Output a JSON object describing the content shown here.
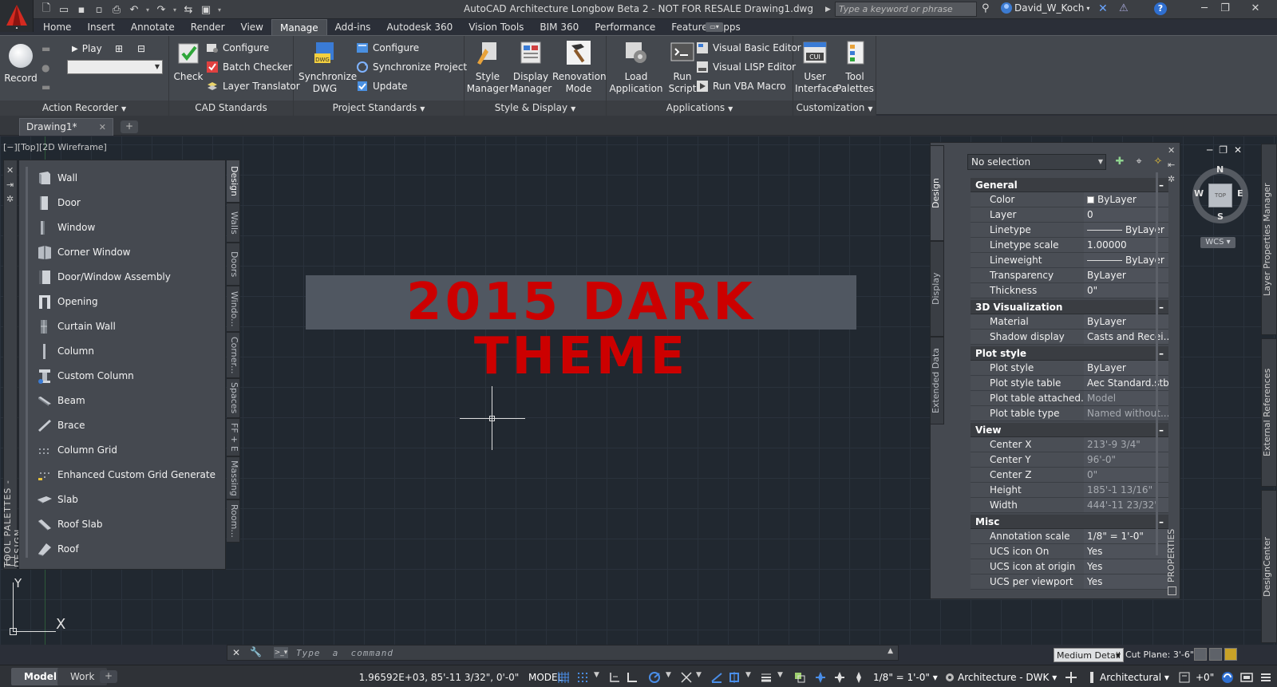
{
  "window": {
    "title": "AutoCAD Architecture Longbow Beta 2 - NOT FOR RESALE    Drawing1.dwg",
    "search_placeholder": "Type a keyword or phrase",
    "user": "David_W_Koch",
    "app_letter": "A"
  },
  "ribbon": {
    "tabs": [
      "Home",
      "Insert",
      "Annotate",
      "Render",
      "View",
      "Manage",
      "Add-ins",
      "Autodesk 360",
      "Vision Tools",
      "BIM 360",
      "Performance",
      "Featured Apps"
    ],
    "active_tab": "Manage",
    "panels": {
      "action_recorder": {
        "title": "Action Recorder",
        "record": "Record",
        "play": "Play"
      },
      "cad_standards": {
        "title": "CAD Standards",
        "check": "Check",
        "configure": "Configure",
        "batch_checker": "Batch Checker",
        "layer_translator": "Layer Translator"
      },
      "project_standards": {
        "title": "Project Standards",
        "synchronize_dwg": [
          "Synchronize",
          "DWG"
        ],
        "configure": "Configure",
        "synchronize_project": "Synchronize Project",
        "update": "Update"
      },
      "style_display": {
        "title": "Style & Display",
        "style_manager": [
          "Style",
          "Manager"
        ],
        "display_manager": [
          "Display",
          "Manager"
        ],
        "renovation_mode": [
          "Renovation",
          "Mode"
        ]
      },
      "applications": {
        "title": "Applications",
        "load_application": [
          "Load",
          "Application"
        ],
        "run_script": [
          "Run",
          "Script"
        ],
        "vb_editor": "Visual Basic Editor",
        "lisp_editor": "Visual LISP Editor",
        "run_vba": "Run VBA Macro"
      },
      "customization": {
        "title": "Customization",
        "user_interface": [
          "User",
          "Interface"
        ],
        "tool_palettes": [
          "Tool",
          "Palettes"
        ]
      }
    }
  },
  "doc_tabs": {
    "active": "Drawing1*"
  },
  "viewport_label": "[−][Top][2D Wireframe]",
  "banner_text": "2015 DARK THEME",
  "ucs": {
    "x": "X",
    "y": "Y"
  },
  "tool_palette": {
    "title": "TOOL PALETTES - DESIGN",
    "items": [
      "Wall",
      "Door",
      "Window",
      "Corner Window",
      "Door/Window Assembly",
      "Opening",
      "Curtain Wall",
      "Column",
      "Custom Column",
      "Beam",
      "Brace",
      "Column Grid",
      "Enhanced Custom Grid Generate",
      "Slab",
      "Roof Slab",
      "Roof"
    ],
    "tabs": [
      "Design",
      "Walls",
      "Doors",
      "Windo...",
      "Corner...",
      "Spaces",
      "FF + E",
      "Massing",
      "Room..."
    ],
    "active_tab": "Design"
  },
  "properties": {
    "title": "PROPERTIES",
    "selection": "No selection",
    "tabs": [
      "Design",
      "Display",
      "Extended Data"
    ],
    "categories": [
      {
        "name": "General",
        "rows": [
          {
            "key": "Color",
            "value": "ByLayer",
            "swatch": "color"
          },
          {
            "key": "Layer",
            "value": "0"
          },
          {
            "key": "Linetype",
            "value": "ByLayer",
            "swatch": "line"
          },
          {
            "key": "Linetype scale",
            "value": "1.00000"
          },
          {
            "key": "Lineweight",
            "value": "ByLayer",
            "swatch": "line"
          },
          {
            "key": "Transparency",
            "value": "ByLayer"
          },
          {
            "key": "Thickness",
            "value": "0\""
          }
        ]
      },
      {
        "name": "3D Visualization",
        "rows": [
          {
            "key": "Material",
            "value": "ByLayer"
          },
          {
            "key": "Shadow display",
            "value": "Casts and Recei..."
          }
        ]
      },
      {
        "name": "Plot style",
        "rows": [
          {
            "key": "Plot style",
            "value": "ByLayer"
          },
          {
            "key": "Plot style table",
            "value": "Aec Standard.stb"
          },
          {
            "key": "Plot table attached...",
            "value": "Model",
            "dim": true
          },
          {
            "key": "Plot table type",
            "value": "Named without...",
            "dim": true
          }
        ]
      },
      {
        "name": "View",
        "rows": [
          {
            "key": "Center X",
            "value": "213'-9 3/4\"",
            "dim": true
          },
          {
            "key": "Center Y",
            "value": "96'-0\"",
            "dim": true
          },
          {
            "key": "Center Z",
            "value": "0\"",
            "dim": true
          },
          {
            "key": "Height",
            "value": "185'-1 13/16\"",
            "dim": true
          },
          {
            "key": "Width",
            "value": "444'-11 23/32\"",
            "dim": true
          }
        ]
      },
      {
        "name": "Misc",
        "rows": [
          {
            "key": "Annotation scale",
            "value": "1/8\" = 1'-0\""
          },
          {
            "key": "UCS icon On",
            "value": "Yes"
          },
          {
            "key": "UCS icon at origin",
            "value": "Yes"
          },
          {
            "key": "UCS per viewport",
            "value": "Yes"
          }
        ]
      }
    ]
  },
  "viewcube": {
    "n": "N",
    "s": "S",
    "e": "E",
    "w": "W",
    "face": "TOP",
    "wcs": "WCS"
  },
  "side_palettes": [
    "Layer Properties Manager",
    "External References",
    "DesignCenter"
  ],
  "command_line": {
    "placeholder": "Type  a  command"
  },
  "detail": {
    "level": "Medium Detail",
    "cut_plane": "Cut Plane:  3'-6\""
  },
  "statusbar": {
    "layout_tabs": [
      "Model",
      "Work"
    ],
    "active_layout": "Model",
    "coords": "1.96592E+03, 85'-11 3/32\", 0'-0\"",
    "mode": "MODEL",
    "scale": "1/8\" = 1'-0\"",
    "workspace": "Architecture - DWK",
    "units": "Architectural",
    "offset": "+0\""
  },
  "colors": {
    "accent": "#cc0000",
    "canvas": "#212830",
    "panel": "#454950"
  }
}
